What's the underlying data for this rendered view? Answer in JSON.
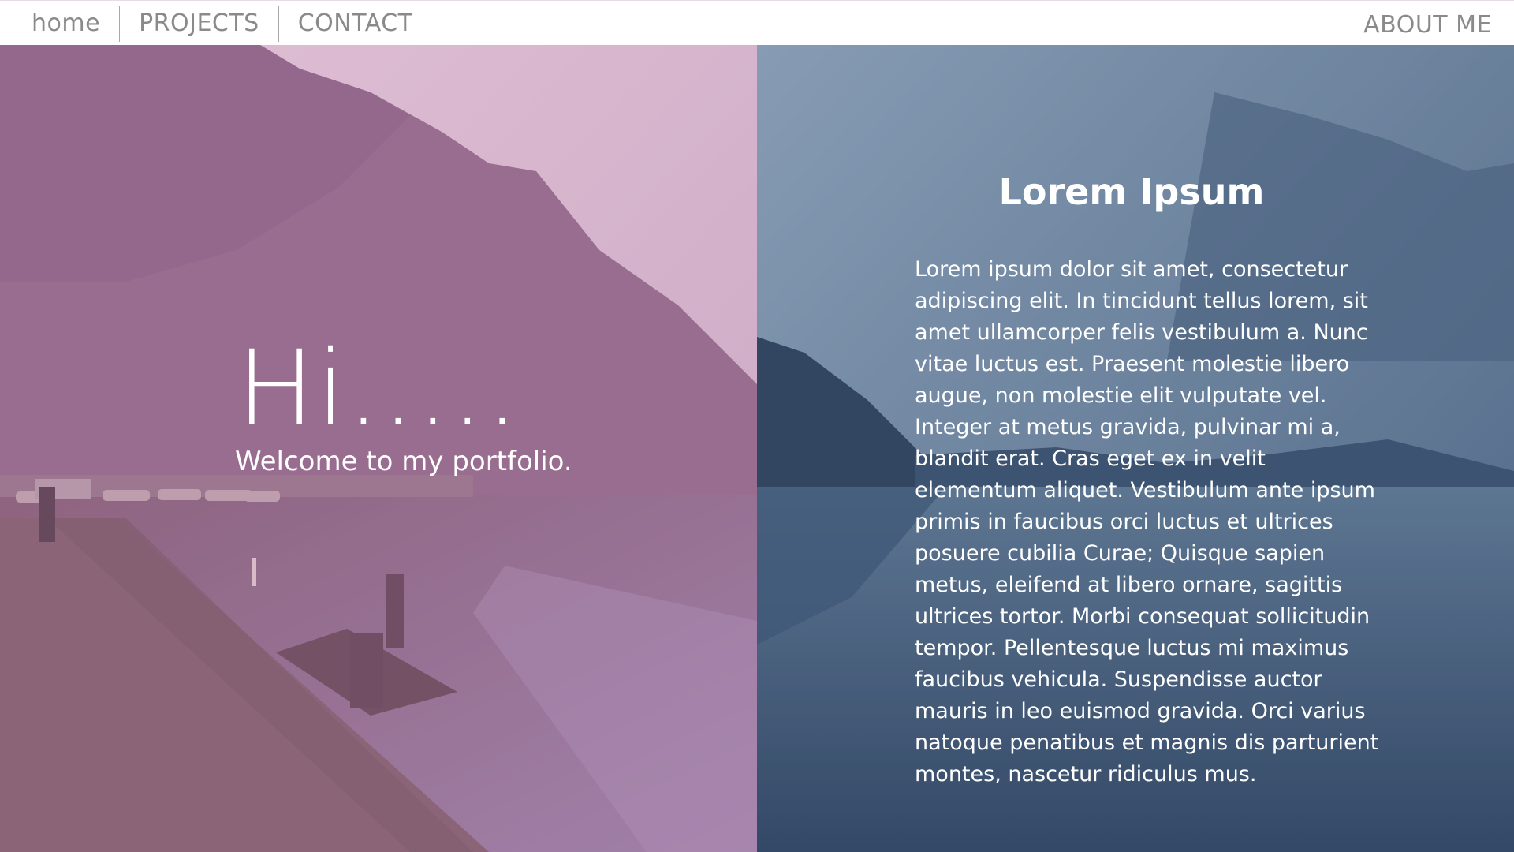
{
  "nav": {
    "home_label": "home",
    "projects_label": "PROJECTS",
    "contact_label": "CONTACT",
    "about_label": "ABOUT ME"
  },
  "hero": {
    "greeting": "Hi.....",
    "subtitle": "Welcome to my portfolio."
  },
  "info": {
    "title": "Lorem Ipsum",
    "body": "Lorem ipsum dolor sit amet, consectetur adipiscing elit. In tincidunt tellus lorem, sit amet ullamcorper felis vestibulum a. Nunc vitae luctus est. Praesent molestie libero augue, non molestie elit vulputate vel. Integer at metus gravida, pulvinar mi a, blandit erat. Cras eget ex in velit elementum aliquet. Vestibulum ante ipsum primis in faucibus orci luctus et ultrices posuere cubilia Curae; Quisque sapien metus, eleifend at libero ornare, sagittis ultrices tortor. Morbi consequat sollicitudin tempor. Pellentesque luctus mi maximus faucibus vehicula. Suspendisse auctor mauris in leo euismod gravida. Orci varius natoque penatibus et magnis dis parturient montes, nascetur ridiculus mus."
  },
  "colors": {
    "left_tint": "#8f627f",
    "right_tint": "#4f6786",
    "nav_text": "#8a8a8a"
  }
}
